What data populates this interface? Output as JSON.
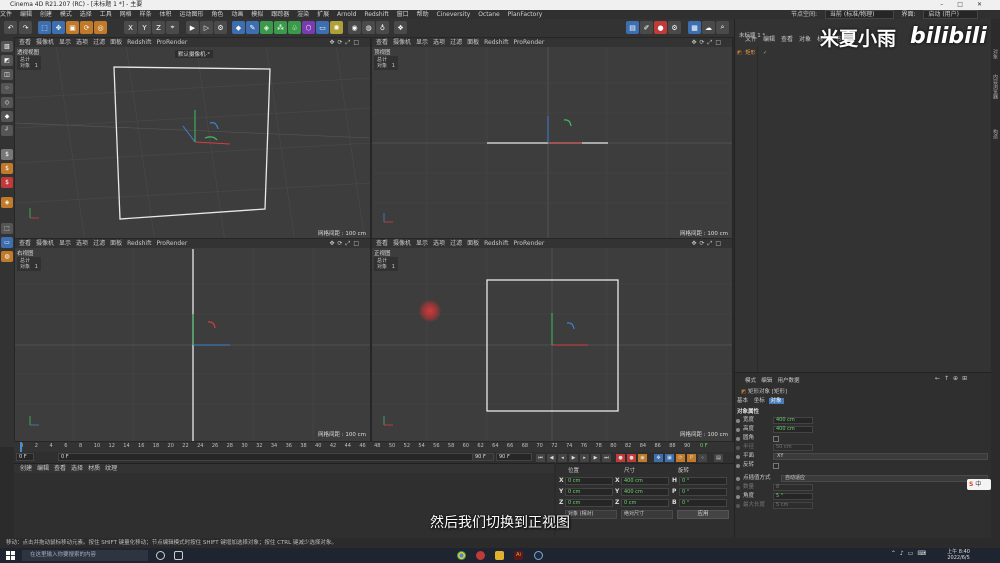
{
  "window": {
    "title": "Cinema 4D R21.207 (RC) - [未标题 1 *] - 主要"
  },
  "menubar": {
    "items": [
      "文件",
      "编辑",
      "创建",
      "模式",
      "选择",
      "工具",
      "网格",
      "样条",
      "体积",
      "运动图形",
      "角色",
      "动画",
      "模拟",
      "跟踪器",
      "渲染",
      "扩展",
      "Arnold",
      "Redshift",
      "窗口",
      "帮助",
      "Cineversity",
      "Octane",
      "PlanFactory"
    ],
    "layout_label": "节点空间:",
    "layout_value": "当前 (标准/物理)",
    "ui_label": "界面:",
    "ui_value": "启动 (用户)"
  },
  "toolbar": {
    "axis_x": "X",
    "axis_y": "Y",
    "axis_z": "Z"
  },
  "viewports": [
    {
      "name": "透视视图",
      "menu": [
        "查看",
        "摄像机",
        "显示",
        "选项",
        "过滤",
        "面板",
        "Redshift",
        "ProRender"
      ],
      "stats_label": "总计",
      "stats_row": "对象",
      "stats_value": "1",
      "grid": "网格间距 : 100 cm",
      "camera": "默认摄像机·°"
    },
    {
      "name": "顶视图",
      "menu": [
        "查看",
        "摄像机",
        "显示",
        "选项",
        "过滤",
        "面板",
        "Redshift",
        "ProRender"
      ],
      "stats_label": "总计",
      "stats_row": "对象",
      "stats_value": "1",
      "grid": "网格间距 : 100 cm"
    },
    {
      "name": "右视图",
      "menu": [
        "查看",
        "摄像机",
        "显示",
        "选项",
        "过滤",
        "面板",
        "Redshift",
        "ProRender"
      ],
      "stats_label": "总计",
      "stats_row": "对象",
      "stats_value": "1",
      "grid": "网格间距 : 100 cm"
    },
    {
      "name": "正视图",
      "menu": [
        "查看",
        "摄像机",
        "显示",
        "选项",
        "过滤",
        "面板",
        "Redshift",
        "ProRender"
      ],
      "stats_label": "总计",
      "stats_row": "对象",
      "stats_value": "1",
      "grid": "网格间距 : 100 cm"
    }
  ],
  "timeline": {
    "ticks": [
      "0",
      "2",
      "4",
      "6",
      "8",
      "10",
      "12",
      "14",
      "16",
      "18",
      "20",
      "22",
      "24",
      "26",
      "28",
      "30",
      "32",
      "34",
      "36",
      "38",
      "40",
      "42",
      "44",
      "46",
      "48",
      "50",
      "52",
      "54",
      "56",
      "58",
      "60",
      "62",
      "64",
      "66",
      "68",
      "70",
      "72",
      "74",
      "76",
      "78",
      "80",
      "82",
      "84",
      "86",
      "88",
      "90"
    ],
    "end_marker": "0 F",
    "current_frame": "0 F",
    "start_field": "0 F",
    "end_field1": "90 F",
    "end_field2": "90 F"
  },
  "material_panel": {
    "menu": [
      "创建",
      "编辑",
      "查看",
      "选择",
      "材质",
      "纹理"
    ]
  },
  "coord_panel": {
    "headers": {
      "position": "位置",
      "size": "尺寸",
      "rotation": "旋转"
    },
    "rows": [
      {
        "axis": "X",
        "pos": "0 cm",
        "size_axis": "X",
        "size": "400 cm",
        "rot_axis": "H",
        "rot": "0 °"
      },
      {
        "axis": "Y",
        "pos": "0 cm",
        "size_axis": "Y",
        "size": "400 cm",
        "rot_axis": "P",
        "rot": "0 °"
      },
      {
        "axis": "Z",
        "pos": "0 cm",
        "size_axis": "Z",
        "size": "0 cm",
        "rot_axis": "B",
        "rot": "0 °"
      }
    ],
    "mode_dropdown": "对象 (相对)",
    "size_dropdown": "绝对尺寸",
    "apply": "应用"
  },
  "object_panel": {
    "tab": "未标题 1 *",
    "menu": [
      "文件",
      "编辑",
      "查看",
      "对象",
      "标签",
      "书签"
    ],
    "object_name": "矩形"
  },
  "attr_panel": {
    "menu": [
      "模式",
      "编辑",
      "用户数据"
    ],
    "object_title": "矩形对象 [矩形]",
    "tabs": [
      "基本",
      "坐标",
      "对象"
    ],
    "section": "对象属性",
    "fields": [
      {
        "label": "宽度",
        "value": "400 cm",
        "kind": "value"
      },
      {
        "label": "高度",
        "value": "400 cm",
        "kind": "value"
      },
      {
        "label": "圆角",
        "value": "",
        "kind": "check"
      },
      {
        "label": "半径",
        "value": "50 cm",
        "kind": "value"
      },
      {
        "label": "平面",
        "value": "XY",
        "kind": "drop"
      },
      {
        "label": "反转",
        "value": "",
        "kind": "check"
      },
      {
        "label": "点插值方式",
        "value": "自动适应",
        "kind": "drop"
      },
      {
        "label": "数量",
        "value": "8",
        "kind": "value"
      },
      {
        "label": "角度",
        "value": "5 °",
        "kind": "value"
      },
      {
        "label": "最大长度",
        "value": "5 cm",
        "kind": "value"
      }
    ]
  },
  "right_strip": {
    "labels": [
      "对象",
      "内容浏览器",
      "构造"
    ]
  },
  "status_bar": {
    "text": "移动：点击并拖动鼠标移动元素。按住 SHIFT 键量化移动；节点编辑模式时按住 SHIFT 键增加选择对象；按住 CTRL 键减少选择对象。"
  },
  "taskbar": {
    "search_placeholder": "在这里输入你要搜索的内容",
    "time": "上午 8:40",
    "date": "2022/6/5"
  },
  "overlay": {
    "subtitle": "然后我们切换到正视图",
    "watermark": "米夏小雨",
    "logo": "bilibili",
    "ime": "中"
  },
  "colors": {
    "x_axis": "#d04040",
    "y_axis": "#40c060",
    "z_axis": "#4080d0",
    "spline": "#e8e8e8",
    "cursor": "#d03c3c"
  }
}
